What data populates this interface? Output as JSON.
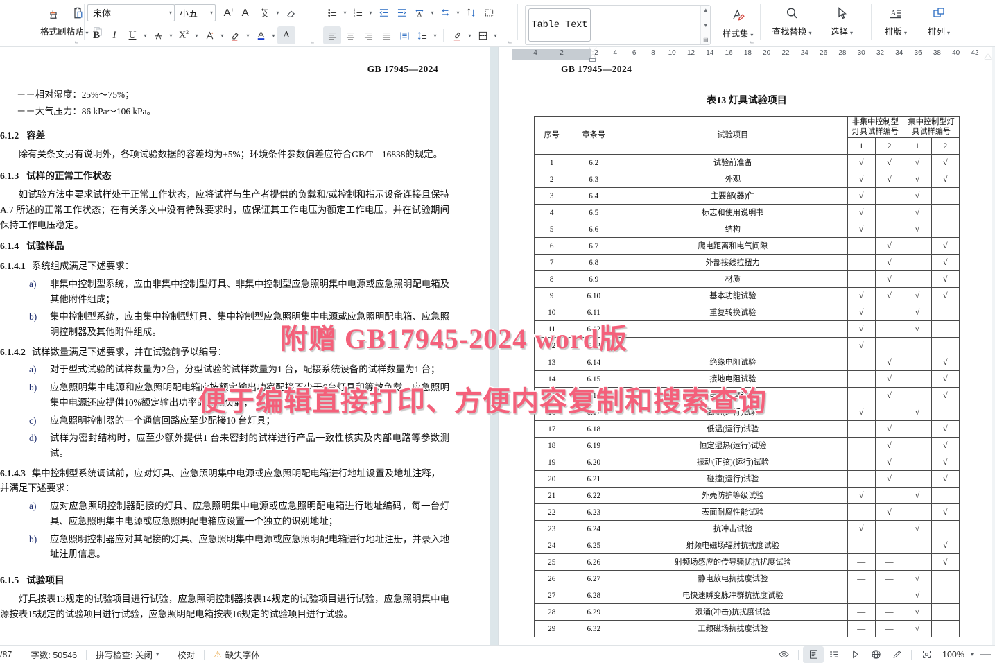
{
  "ribbon": {
    "clipboard": {
      "format_painter": "格式刷",
      "paste": "粘贴",
      "cut_icon": "scissors-icon",
      "copy_icon": "copy-icon"
    },
    "font": {
      "name_value": "宋体",
      "size_value": "小五",
      "grow_icon": "increase-font-size-icon",
      "shrink_icon": "decrease-font-size-icon",
      "phonetic_icon": "phonetic-guide-icon",
      "clear_format_icon": "clear-formatting-icon",
      "bold": "B",
      "italic": "I",
      "underline": "U",
      "strikethrough_icon": "strikethrough-icon",
      "superscript": "X",
      "superscript_sup": "2",
      "text_highlight_icon": "text-highlight-icon",
      "text_effect_icon": "text-effect-icon",
      "font_color_icon": "font-color-icon",
      "char_shading_icon": "character-shading-icon"
    },
    "paragraph": {
      "bullets_icon": "bullet-list-icon",
      "numbering_icon": "numbered-list-icon",
      "decrease_indent_icon": "decrease-indent-icon",
      "increase_indent_icon": "increase-indent-icon",
      "pinyin_icon": "chinese-layout-icon",
      "ltr_rtl_icon": "text-direction-icon",
      "sort_icon": "sort-icon",
      "show_marks_icon": "show-formatting-marks-icon",
      "align_left_icon": "align-left-icon",
      "align_center_icon": "align-center-icon",
      "align_right_icon": "align-right-icon",
      "align_justify_icon": "align-justify-icon",
      "distribute_icon": "distributed-align-icon",
      "line_spacing_icon": "line-spacing-icon",
      "shading_icon": "paragraph-shading-icon",
      "borders_icon": "borders-icon"
    },
    "styles": {
      "current_style": "Table Text",
      "style_set_label": "样式集",
      "style_set_icon": "style-set-icon"
    },
    "editing": {
      "find_replace_label": "查找替换",
      "find_replace_icon": "search-icon",
      "select_label": "选择",
      "select_icon": "cursor-select-icon"
    },
    "layout": {
      "typeset_label": "排版",
      "typeset_icon": "typesetting-icon",
      "arrange_label": "排列",
      "arrange_icon": "arrange-objects-icon"
    }
  },
  "ruler": {
    "margin_ticks": [
      "4",
      "2"
    ],
    "page_ticks": [
      "2",
      "4",
      "6",
      "8",
      "10",
      "12",
      "14",
      "16",
      "18",
      "20",
      "22",
      "24",
      "26",
      "28",
      "30",
      "32",
      "34",
      "36",
      "38",
      "40",
      "42"
    ]
  },
  "document": {
    "page_header": "GB  17945—2024",
    "left_page": {
      "intro_lines": [
        "－－相对湿度：25%～75%；",
        "－－大气压力：86 kPa～106  kPa。"
      ],
      "sections": [
        {
          "num": "6.1.2",
          "title": "容差",
          "paras": [
            "除有关条文另有说明外，各项试验数据的容差均为±5%；环境条件参数偏差应符合GB/T　16838的规定。"
          ]
        },
        {
          "num": "6.1.3",
          "title": "试样的正常工作状态",
          "paras": [
            "如试验方法中要求试样处于正常工作状态，应将试样与生产者提供的负载和/或控制和指示设备连接且保持 A.7 所述的正常工作状态；在有关条文中没有特殊要求时，应保证其工作电压为额定工作电压，并在试验期间保持工作电压稳定。"
          ]
        },
        {
          "num": "6.1.4",
          "title": "试验样品",
          "paras": []
        }
      ],
      "clause_6141": {
        "num": "6.1.4.1",
        "text": "系统组成满足下述要求：",
        "items": [
          {
            "mark": "a)",
            "text": "非集中控制型系统，应由非集中控制型灯具、非集中控制型应急照明集中电源或应急照明配电箱及其他附件组成；"
          },
          {
            "mark": "b)",
            "text": "集中控制型系统，应由集中控制型灯具、集中控制型应急照明集中电源或应急照明配电箱、应急照明控制器及其他附件组成。"
          }
        ]
      },
      "clause_6142": {
        "num": "6.1.4.2",
        "text": "试样数量满足下述要求，并在试验前予以编号：",
        "items": [
          {
            "mark": "a)",
            "text": "对于型式试验的试样数量为2台，分型试验的试样数量为1 台，配接系统设备的试样数量为1 台；"
          },
          {
            "mark": "b)",
            "text": "应急照明集中电源和应急照明配电箱应按额定输出功率配接不少于6台灯具和等效负载，应急照明集中电源还应提供10%额定输出功率的等效负载；"
          },
          {
            "mark": "c)",
            "text": "应急照明控制器的一个通信回路应至少配接10 台灯具；"
          },
          {
            "mark": "d)",
            "text": "试样为密封结构时，应至少额外提供1 台未密封的试样进行产品一致性核实及内部电路等参数测试。"
          }
        ]
      },
      "clause_6143": {
        "num": "6.1.4.3",
        "text": "集中控制型系统调试前，应对灯具、应急照明集中电源或应急照明配电箱进行地址设置及地址注释，并满足下述要求：",
        "items": [
          {
            "mark": "a)",
            "text": "应对应急照明控制器配接的灯具、应急照明集中电源或应急照明配电箱进行地址编码，每一台灯具、应急照明集中电源或应急照明配电箱应设置一个独立的识别地址；"
          },
          {
            "mark": "b)",
            "text": "应急照明控制器应对其配接的灯具、应急照明集中电源或应急照明配电箱进行地址注册，并录入地址注册信息。"
          }
        ]
      },
      "clause_615": {
        "num": "6.1.5",
        "title": "试验项目",
        "para": "灯具按表13规定的试验项目进行试验，应急照明控制器按表14规定的试验项目进行试验，应急照明集中电源按表15规定的试验项目进行试验，应急照明配电箱按表16规定的试验项目进行试验。"
      }
    }
  },
  "table13": {
    "title": "表13   灯具试验项目",
    "headers": {
      "seq": "序号",
      "article": "章条号",
      "item": "试验项目",
      "group_noncentral": "非集中控制型灯具试样编号",
      "group_central": "集中控制型灯具试样编号",
      "sub": [
        "1",
        "2",
        "1",
        "2"
      ]
    },
    "check_mark": "√",
    "dash_mark": "—",
    "rows": [
      {
        "no": "1",
        "art": "6.2",
        "item": "试验前准备",
        "m": [
          "√",
          "√",
          "√",
          "√"
        ]
      },
      {
        "no": "2",
        "art": "6.3",
        "item": "外观",
        "m": [
          "√",
          "√",
          "√",
          "√"
        ]
      },
      {
        "no": "3",
        "art": "6.4",
        "item": "主要部(器)件",
        "m": [
          "√",
          "",
          "√",
          ""
        ]
      },
      {
        "no": "4",
        "art": "6.5",
        "item": "标志和使用说明书",
        "m": [
          "√",
          "",
          "√",
          ""
        ]
      },
      {
        "no": "5",
        "art": "6.6",
        "item": "结构",
        "m": [
          "√",
          "",
          "√",
          ""
        ]
      },
      {
        "no": "6",
        "art": "6.7",
        "item": "爬电距离和电气间隙",
        "m": [
          "",
          "√",
          "",
          "√"
        ]
      },
      {
        "no": "7",
        "art": "6.8",
        "item": "外部接线拉扭力",
        "m": [
          "",
          "√",
          "",
          "√"
        ]
      },
      {
        "no": "8",
        "art": "6.9",
        "item": "材质",
        "m": [
          "",
          "√",
          "",
          "√"
        ]
      },
      {
        "no": "9",
        "art": "6.10",
        "item": "基本功能试验",
        "m": [
          "√",
          "√",
          "√",
          "√"
        ]
      },
      {
        "no": "10",
        "art": "6.11",
        "item": "重复转换试验",
        "m": [
          "√",
          "",
          "√",
          ""
        ]
      },
      {
        "no": "11",
        "art": "6.12",
        "item": "",
        "m": [
          "√",
          "",
          "√",
          ""
        ]
      },
      {
        "no": "12",
        "art": "6.13",
        "item": "",
        "m": [
          "√",
          "",
          "",
          ""
        ]
      },
      {
        "no": "13",
        "art": "6.14",
        "item": "绝缘电阻试验",
        "m": [
          "",
          "√",
          "",
          "√"
        ]
      },
      {
        "no": "14",
        "art": "6.15",
        "item": "接地电阻试验",
        "m": [
          "",
          "√",
          "",
          "√"
        ]
      },
      {
        "no": "15",
        "art": "6.16",
        "item": "电气强度试验",
        "m": [
          "",
          "√",
          "",
          "√"
        ]
      },
      {
        "no": "16",
        "art": "6.17",
        "item": "高温(运行)试验",
        "m": [
          "√",
          "",
          "√",
          ""
        ]
      },
      {
        "no": "17",
        "art": "6.18",
        "item": "低温(运行)试验",
        "m": [
          "",
          "√",
          "",
          "√"
        ]
      },
      {
        "no": "18",
        "art": "6.19",
        "item": "恒定湿热(运行)试验",
        "m": [
          "",
          "√",
          "",
          "√"
        ]
      },
      {
        "no": "19",
        "art": "6.20",
        "item": "振动(正弦)(运行)试验",
        "m": [
          "",
          "√",
          "",
          "√"
        ]
      },
      {
        "no": "20",
        "art": "6.21",
        "item": "碰撞(运行)试验",
        "m": [
          "",
          "√",
          "",
          "√"
        ]
      },
      {
        "no": "21",
        "art": "6.22",
        "item": "外壳防护等级试验",
        "m": [
          "√",
          "",
          "√",
          ""
        ]
      },
      {
        "no": "22",
        "art": "6.23",
        "item": "表面耐腐性能试验",
        "m": [
          "",
          "√",
          "",
          "√"
        ]
      },
      {
        "no": "23",
        "art": "6.24",
        "item": "抗冲击试验",
        "m": [
          "√",
          "",
          "√",
          ""
        ]
      },
      {
        "no": "24",
        "art": "6.25",
        "item": "射频电磁场辐射抗扰度试验",
        "m": [
          "—",
          "—",
          "",
          "√"
        ]
      },
      {
        "no": "25",
        "art": "6.26",
        "item": "射频场感应的传导骚扰抗扰度试验",
        "m": [
          "—",
          "—",
          "",
          "√"
        ]
      },
      {
        "no": "26",
        "art": "6.27",
        "item": "静电放电抗扰度试验",
        "m": [
          "—",
          "—",
          "√",
          ""
        ]
      },
      {
        "no": "27",
        "art": "6.28",
        "item": "电快速瞬变脉冲群抗扰度试验",
        "m": [
          "—",
          "—",
          "√",
          ""
        ]
      },
      {
        "no": "28",
        "art": "6.29",
        "item": "浪涌(冲击)抗扰度试验",
        "m": [
          "—",
          "—",
          "√",
          ""
        ]
      },
      {
        "no": "29",
        "art": "6.32",
        "item": "工频磁场抗扰度试验",
        "m": [
          "—",
          "—",
          "√",
          ""
        ]
      }
    ]
  },
  "watermark": {
    "line1": "附赠  GB17945-2024  word版",
    "line2": "便于编辑直接打印、方便内容复制和搜索查询"
  },
  "statusbar": {
    "page_indicator": "/87",
    "word_count": "字数: 50546",
    "spell_check": "拼写检查: 关闭",
    "proofread": "校对",
    "missing_font": "缺失字体",
    "warning_icon": "warning-icon",
    "eye_icon": "preview-icon",
    "page_view_icon": "print-layout-view-icon",
    "outline_view_icon": "outline-view-icon",
    "read_view_icon": "read-mode-icon",
    "web_view_icon": "web-layout-view-icon",
    "pen_icon": "pen-tool-icon",
    "fullscreen_icon": "fullscreen-icon",
    "zoom_level": "100%",
    "zoom_out_icon": "zoom-out-icon"
  }
}
